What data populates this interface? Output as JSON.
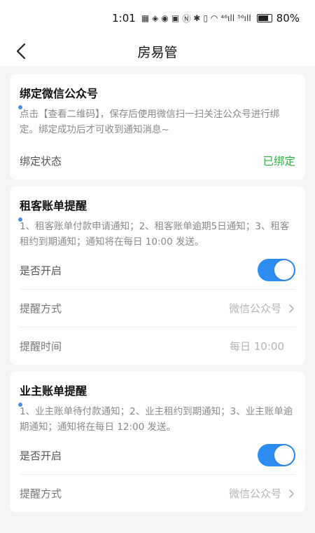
{
  "status_bar": {
    "time": "1:01",
    "battery_pct": "80%",
    "signal": "⁴⁶ıll",
    "signal2": "⁵⁶ıll"
  },
  "nav": {
    "title": "房易管"
  },
  "cards": [
    {
      "title": "绑定微信公众号",
      "desc": "点击【查看二维码】，保存后使用微信扫一扫关注公众号进行绑定。绑定成功后才可收到通知消息~",
      "status_label": "绑定状态",
      "status_value": "已绑定"
    },
    {
      "title": "租客账单提醒",
      "desc": "1、租客账单付款申请通知；2、租客账单逾期5日通知；3、租客租约到期通知；通知将在每日 10:00 发送。",
      "enable_label": "是否开启",
      "enabled": true,
      "method_label": "提醒方式",
      "method_value": "微信公众号",
      "time_label": "提醒时间",
      "time_value": "每日 10:00"
    },
    {
      "title": "业主账单提醒",
      "desc": "1、业主账单待付款通知；2、业主租约到期通知；3、业主账单逾期通知；通知将在每日 12:00 发送。",
      "enable_label": "是否开启",
      "enabled": true,
      "method_label": "提醒方式",
      "method_value": "微信公众号"
    }
  ],
  "colors": {
    "accent": "#2d8cf0",
    "success": "#2fb344",
    "muted_text": "#8a8a8a"
  }
}
